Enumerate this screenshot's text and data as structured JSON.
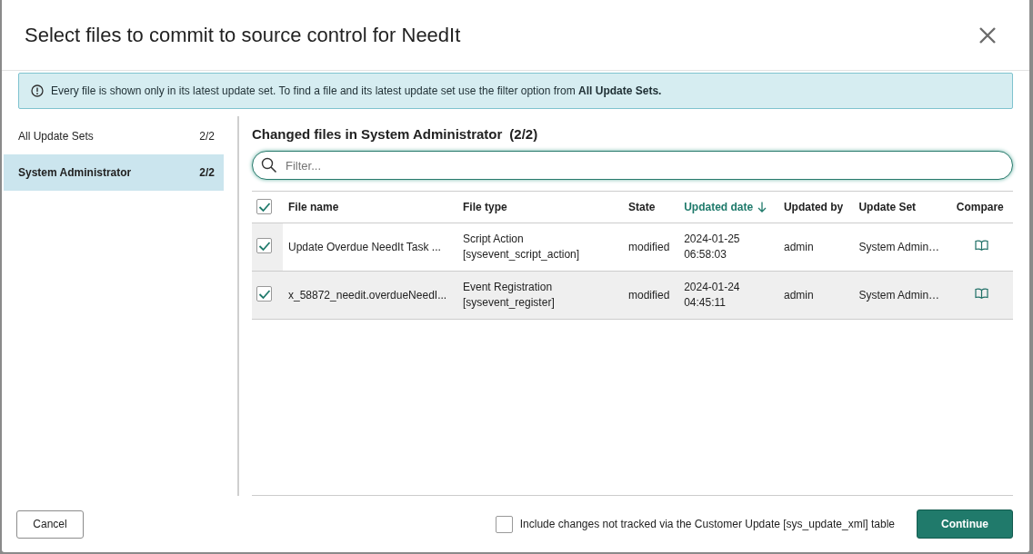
{
  "dialog": {
    "title": "Select files to commit to source control for NeedIt"
  },
  "notice": {
    "text": "Every file is shown only in its latest update set. To find a file and its latest update set use the filter option from **All Update Sets.**"
  },
  "sidebar": {
    "items": [
      {
        "label": "All Update Sets",
        "count": "2/2",
        "selected": false
      },
      {
        "label": "System Administrator",
        "count": "2/2",
        "selected": true
      }
    ]
  },
  "main": {
    "heading": "Changed files in System Administrator",
    "heading_count": "(2/2)",
    "filter": {
      "placeholder": "Filter..."
    }
  },
  "table": {
    "all_checked": true,
    "columns": [
      {
        "label": "File name",
        "sorted": false
      },
      {
        "label": "File type",
        "sorted": false
      },
      {
        "label": "State",
        "sorted": false
      },
      {
        "label": "Updated date",
        "sorted": true
      },
      {
        "label": "Updated by",
        "sorted": false
      },
      {
        "label": "Update Set",
        "sorted": false
      },
      {
        "label": "Compare",
        "sorted": false
      }
    ],
    "rows": [
      {
        "checked": true,
        "highlighted": false,
        "file_name": "Update Overdue NeedIt Task ...",
        "type": "Script Action",
        "type_table": "[sysevent_script_action]",
        "state": "modified",
        "date": "2024-01-25",
        "time": "06:58:03",
        "updated_by": "admin",
        "update_set": "System Admin…"
      },
      {
        "checked": true,
        "highlighted": true,
        "file_name": "x_58872_needit.overdueNeedI...",
        "type": "Event Registration",
        "type_table": "[sysevent_register]",
        "state": "modified",
        "date": "2024-01-24",
        "time": "04:45:11",
        "updated_by": "admin",
        "update_set": "System Admin…"
      }
    ]
  },
  "footer": {
    "cancel": "Cancel",
    "include_untracked": {
      "label": "Include changes not tracked via the Customer Update [sys_update_xml] table",
      "checked": false
    },
    "continue": "Continue"
  }
}
